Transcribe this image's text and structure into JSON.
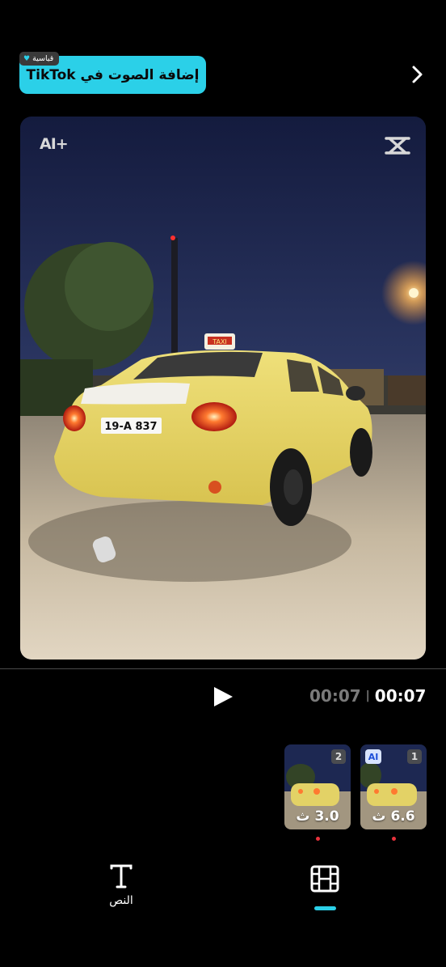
{
  "header": {
    "add_sound_label": "إضافة الصوت في TikTok",
    "standard_badge": "قياسية",
    "forward_icon": "chevron-right-icon"
  },
  "preview": {
    "ai_badge": "AI+",
    "logo": "capcut-logo-icon",
    "plate_text": "19-A  837",
    "roof_sign": "TAXI"
  },
  "playback": {
    "current_time": "00:07",
    "total_time": "00:07",
    "separator": "|",
    "play_icon": "play-icon"
  },
  "clips": [
    {
      "index": "1",
      "duration": "6.6 ث",
      "has_ai": true,
      "ai_label": "AI"
    },
    {
      "index": "2",
      "duration": "3.0 ث",
      "has_ai": false
    }
  ],
  "toolbar": {
    "text_tool_label": "النص",
    "text_tool_icon": "text-T-icon",
    "clips_tool_icon": "film-strip-icon"
  },
  "colors": {
    "accent": "#2bd0e8",
    "marker": "#e8323c",
    "background": "#000000"
  }
}
